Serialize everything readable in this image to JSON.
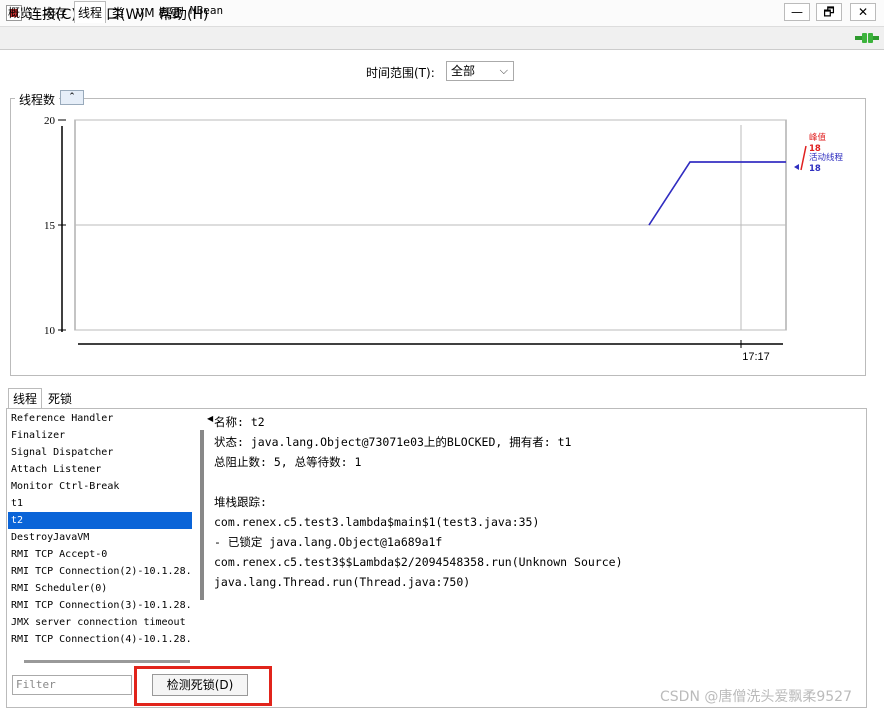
{
  "menu": [
    "连接(C)",
    "窗口(W)",
    "帮助(H)"
  ],
  "window_buttons": {
    "minimize": "—",
    "restore": "🗗",
    "close": "✕"
  },
  "tabs": [
    "概览",
    "内存",
    "线程",
    "类",
    "VM 概要",
    "MBean"
  ],
  "active_tab": "线程",
  "time_range": {
    "label": "时间范围(T):",
    "value": "全部"
  },
  "chart_group_title": "线程数",
  "chart_data": {
    "type": "line",
    "y_ticks": [
      10,
      15,
      20
    ],
    "ylim": [
      10,
      20
    ],
    "x_ticks": [
      "17:17"
    ],
    "series": [
      {
        "name": "峰值",
        "value_label": "18",
        "color": "#e02020",
        "values": [
          15,
          18,
          18
        ]
      },
      {
        "name": "活动线程",
        "value_label": "18",
        "color": "#3030c0",
        "values": [
          15,
          18,
          18
        ]
      }
    ]
  },
  "lower_tabs": [
    "线程",
    "死锁"
  ],
  "threads": [
    "Reference Handler",
    "Finalizer",
    "Signal Dispatcher",
    "Attach Listener",
    "Monitor Ctrl-Break",
    "t1",
    "t2",
    "DestroyJavaVM",
    "RMI TCP Accept-0",
    "RMI TCP Connection(2)-10.1.28.",
    "RMI Scheduler(0)",
    "RMI TCP Connection(3)-10.1.28.",
    "JMX server connection timeout",
    "RMI TCP Connection(4)-10.1.28."
  ],
  "selected_thread": "t2",
  "detail": [
    "名称: t2",
    "状态: java.lang.Object@73071e03上的BLOCKED, 拥有者: t1",
    "总阻止数: 5, 总等待数: 1",
    "",
    "堆栈跟踪:",
    "com.renex.c5.test3.lambda$main$1(test3.java:35)",
    "   - 已锁定 java.lang.Object@1a689a1f",
    "com.renex.c5.test3$$Lambda$2/2094548358.run(Unknown Source)",
    "java.lang.Thread.run(Thread.java:750)"
  ],
  "filter_placeholder": "Filter",
  "detect_button": "检测死锁(D)",
  "watermark": "CSDN @唐僧洗头爱飘柔9527"
}
